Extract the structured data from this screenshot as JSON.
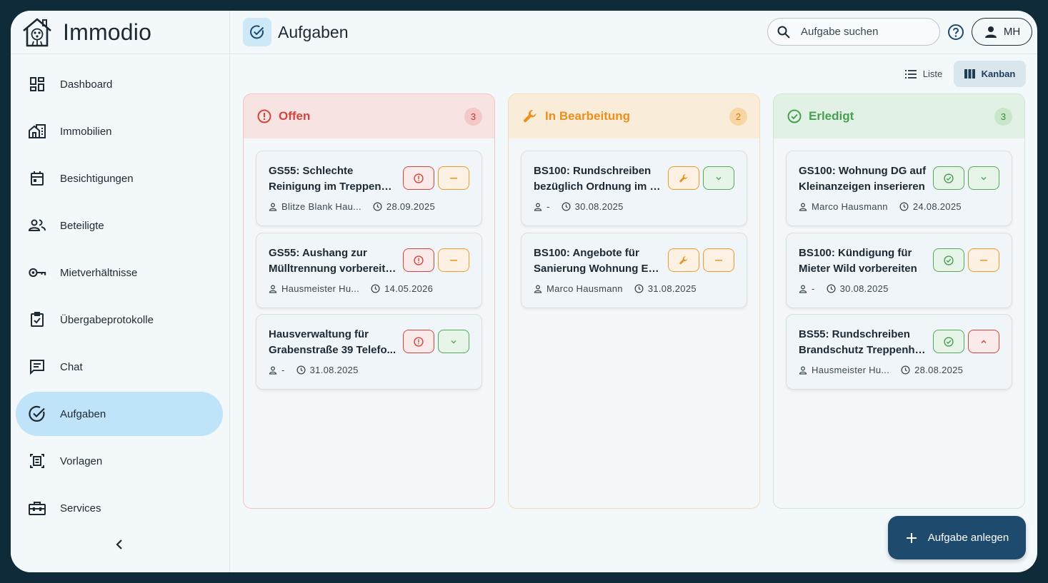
{
  "app": {
    "name": "Immodio"
  },
  "sidebar": {
    "items": [
      {
        "label": "Dashboard",
        "icon": "dashboard-icon"
      },
      {
        "label": "Immobilien",
        "icon": "buildings-icon"
      },
      {
        "label": "Besichtigungen",
        "icon": "calendar-icon"
      },
      {
        "label": "Beteiligte",
        "icon": "people-icon"
      },
      {
        "label": "Mietverhältnisse",
        "icon": "key-icon"
      },
      {
        "label": "Übergabeprotokolle",
        "icon": "checklist-icon"
      },
      {
        "label": "Chat",
        "icon": "chat-icon"
      },
      {
        "label": "Aufgaben",
        "icon": "check-circle-icon",
        "active": true
      },
      {
        "label": "Vorlagen",
        "icon": "template-icon"
      },
      {
        "label": "Services",
        "icon": "toolbox-icon"
      }
    ]
  },
  "header": {
    "title": "Aufgaben",
    "search_placeholder": "Aufgabe suchen",
    "user_initials": "MH"
  },
  "view_toggle": {
    "liste": "Liste",
    "kanban": "Kanban",
    "active": "kanban"
  },
  "columns": [
    {
      "title": "Offen",
      "count": "3",
      "color": "#d5443c",
      "cards": [
        {
          "line1": "GS55: Schlechte",
          "line2": "Reinigung im Treppenha...",
          "assignee": "Blitze Blank Hau...",
          "date": "28.09.2025",
          "btn1": "red",
          "btn2": "orange"
        },
        {
          "line1": "GS55: Aushang zur",
          "line2": "Mülltrennung vorbereiten.",
          "assignee": "Hausmeister Hu...",
          "date": "14.05.2026",
          "btn1": "red",
          "btn2": "orange"
        },
        {
          "line1": "Hausverwaltung für",
          "line2": "Grabenstraße 39 Telefo...",
          "assignee": "-",
          "date": "31.08.2025",
          "btn1": "red",
          "btn2": "green"
        }
      ]
    },
    {
      "title": "In Bearbeitung",
      "count": "2",
      "color": "#ed8f1b",
      "cards": [
        {
          "line1": "BS100: Rundschreiben",
          "line2": "bezüglich Ordnung im Tr...",
          "assignee": "-",
          "date": "30.08.2025",
          "btn1": "orange",
          "btn2": "green"
        },
        {
          "line1": "BS100: Angebote für",
          "line2": "Sanierung Wohnung EG ...",
          "assignee": "Marco Hausmann",
          "date": "31.08.2025",
          "btn1": "orange",
          "btn2": "orange"
        }
      ]
    },
    {
      "title": "Erledigt",
      "count": "3",
      "color": "#47a04e",
      "cards": [
        {
          "line1": "GS100: Wohnung DG auf",
          "line2": "Kleinanzeigen inserieren",
          "assignee": "Marco Hausmann",
          "date": "24.08.2025",
          "btn1": "green",
          "btn2": "green"
        },
        {
          "line1": "BS100: Kündigung für",
          "line2": "Mieter Wild vorbereiten",
          "assignee": "-",
          "date": "30.08.2025",
          "btn1": "green",
          "btn2": "orange"
        },
        {
          "line1": "BS55: Rundschreiben",
          "line2": "Brandschutz Treppenha...",
          "assignee": "Hausmeister Hu...",
          "date": "28.08.2025",
          "btn1": "green",
          "btn2": "red"
        }
      ]
    }
  ],
  "fab": {
    "label": "Aufgabe anlegen"
  }
}
